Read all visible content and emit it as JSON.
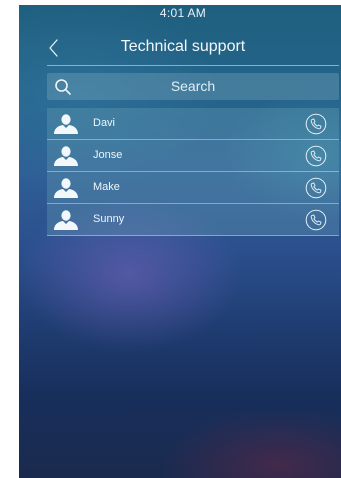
{
  "status_bar": {
    "time": "4:01 AM"
  },
  "header": {
    "title": "Technical support"
  },
  "search": {
    "placeholder": "Search"
  },
  "contacts": [
    {
      "name": "Davi"
    },
    {
      "name": "Jonse"
    },
    {
      "name": "Make"
    },
    {
      "name": "Sunny"
    }
  ],
  "icons": {
    "back": "chevron-left-icon",
    "search": "search-icon",
    "avatar": "person-icon",
    "call": "phone-icon"
  },
  "colors": {
    "text": "#f3f8fb",
    "row_background": "#6ea5b9",
    "divider": "#dcebf5"
  }
}
